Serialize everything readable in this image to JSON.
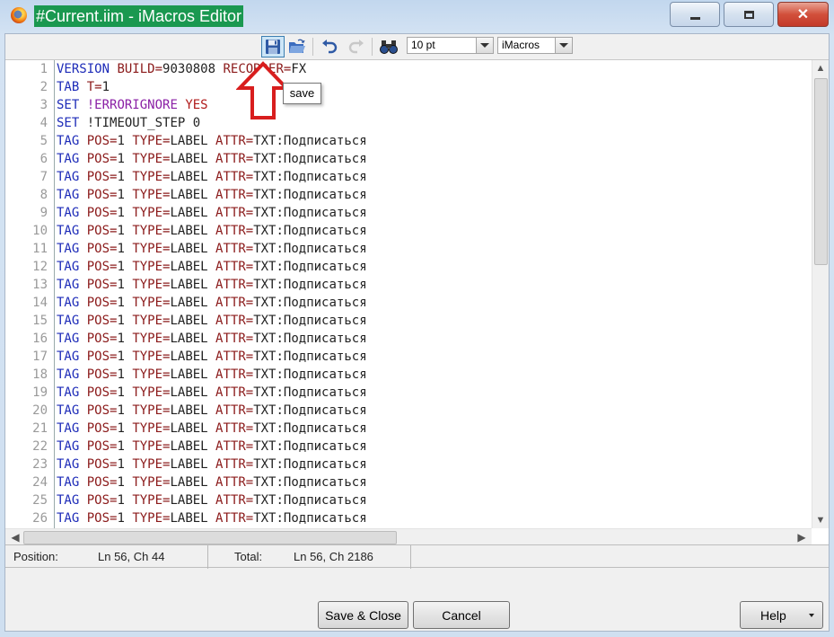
{
  "window": {
    "title": "#Current.iim - iMacros Editor"
  },
  "toolbar": {
    "font_size": "10 pt",
    "mode": "iMacros",
    "save_tooltip": "save"
  },
  "editor": {
    "lines": [
      {
        "n": "1",
        "t": [
          {
            "c": "kw",
            "s": "VERSION"
          },
          {
            "c": "attr",
            "s": " BUILD="
          },
          {
            "c": "val",
            "s": "9030808 "
          },
          {
            "c": "attr",
            "s": "RECORDER="
          },
          {
            "c": "val",
            "s": "FX"
          }
        ]
      },
      {
        "n": "2",
        "t": [
          {
            "c": "kw",
            "s": "TAB"
          },
          {
            "c": "attr",
            "s": " T="
          },
          {
            "c": "val",
            "s": "1"
          }
        ]
      },
      {
        "n": "3",
        "t": [
          {
            "c": "kw",
            "s": "SET"
          },
          {
            "c": "val",
            "s": " "
          },
          {
            "c": "sys",
            "s": "!ERRORIGNORE"
          },
          {
            "c": "val",
            "s": " "
          },
          {
            "c": "red",
            "s": "YES"
          }
        ]
      },
      {
        "n": "4",
        "t": [
          {
            "c": "kw",
            "s": "SET"
          },
          {
            "c": "val",
            "s": " !TIMEOUT_STEP 0"
          }
        ]
      },
      {
        "n": "5",
        "t": "TAG"
      },
      {
        "n": "6",
        "t": "TAG"
      },
      {
        "n": "7",
        "t": "TAG"
      },
      {
        "n": "8",
        "t": "TAG"
      },
      {
        "n": "9",
        "t": "TAG"
      },
      {
        "n": "10",
        "t": "TAG"
      },
      {
        "n": "11",
        "t": "TAG"
      },
      {
        "n": "12",
        "t": "TAG"
      },
      {
        "n": "13",
        "t": "TAG"
      },
      {
        "n": "14",
        "t": "TAG"
      },
      {
        "n": "15",
        "t": "TAG"
      },
      {
        "n": "16",
        "t": "TAG"
      },
      {
        "n": "17",
        "t": "TAG"
      },
      {
        "n": "18",
        "t": "TAG"
      },
      {
        "n": "19",
        "t": "TAG"
      },
      {
        "n": "20",
        "t": "TAG"
      },
      {
        "n": "21",
        "t": "TAG"
      },
      {
        "n": "22",
        "t": "TAG"
      },
      {
        "n": "23",
        "t": "TAG"
      },
      {
        "n": "24",
        "t": "TAG"
      },
      {
        "n": "25",
        "t": "TAG"
      },
      {
        "n": "26",
        "t": "TAG"
      }
    ],
    "tag_line": [
      {
        "c": "kw",
        "s": "TAG"
      },
      {
        "c": "attr",
        "s": " POS="
      },
      {
        "c": "val",
        "s": "1 "
      },
      {
        "c": "attr",
        "s": "TYPE="
      },
      {
        "c": "val",
        "s": "LABEL "
      },
      {
        "c": "attr",
        "s": "ATTR="
      },
      {
        "c": "val",
        "s": "TXT:Подписаться"
      }
    ]
  },
  "status": {
    "position_label": "Position:",
    "position_value": "Ln 56, Ch 44",
    "total_label": "Total:",
    "total_value": "Ln 56, Ch 2186"
  },
  "buttons": {
    "save_close": "Save & Close",
    "cancel": "Cancel",
    "help": "Help"
  },
  "colors": {
    "title_highlight": "#1a9850",
    "keyword": "#1d2bb8",
    "attribute": "#8b1a1a",
    "annotation_arrow": "#d81e1e"
  }
}
